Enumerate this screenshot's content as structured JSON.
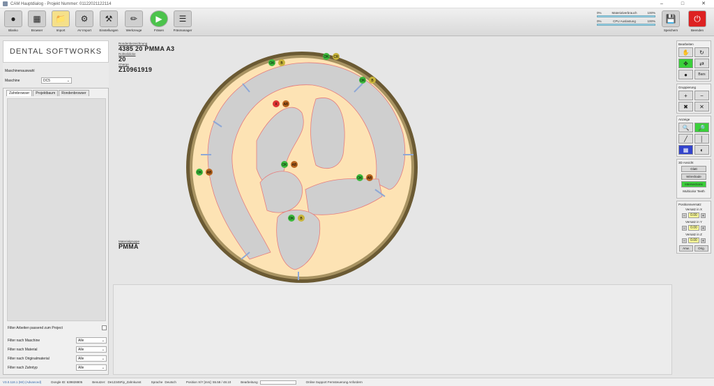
{
  "window": {
    "title": "CAM Hauptdialog - Projekt Nummer: 01122021122114"
  },
  "toolbar": {
    "buttons": [
      {
        "label": "Blanko",
        "icon": "blank-disc-icon"
      },
      {
        "label": "Browser",
        "icon": "browser-icon"
      },
      {
        "label": "Import",
        "icon": "import-icon"
      },
      {
        "label": "AV Import",
        "icon": "av-import-icon"
      },
      {
        "label": "Einstellungen",
        "icon": "settings-icon"
      },
      {
        "label": "Werkzeuge",
        "icon": "tools-icon"
      },
      {
        "label": "Fräsen",
        "icon": "play-icon"
      },
      {
        "label": "Fräsmanager",
        "icon": "mill-manager-icon"
      }
    ],
    "meters": [
      {
        "label": "Materialverbrauch",
        "min": "0%",
        "max": "100%"
      },
      {
        "label": "CPU Auslastung",
        "min": "0%",
        "max": "100%"
      }
    ],
    "save_label": "Speichern",
    "exit_label": "Beenden"
  },
  "left": {
    "logo": "DENTAL SOFTWORKS",
    "machine_section": "Maschinenauswahl",
    "machine_label": "Maschine",
    "machine_value": "DC5",
    "tabs": [
      "Zahnbrowser",
      "Projektbaum",
      "Rondenbrowser"
    ],
    "filter_project": "Filter Arbeiten passend zum Project",
    "filters": [
      {
        "label": "Filter nach Maschine",
        "value": "Alle"
      },
      {
        "label": "Filter nach Material",
        "value": "Alle"
      },
      {
        "label": "Filter nach Originalmaterial",
        "value": "Alle"
      },
      {
        "label": "Filter nach Zahntyp",
        "value": "Alle"
      }
    ]
  },
  "info": {
    "designation_label": "Rondenbezeichnung",
    "designation_value": "4385 20 PMMA A3",
    "thickness_label": "Rohteildicke",
    "thickness_value": "20",
    "batch_label": "Charge",
    "batch_value": "Z10961919",
    "material_group_label": "Materialgruppe",
    "material_group_value": "PMMA"
  },
  "disc": {
    "badges": [
      {
        "a": "OK",
        "b": "B"
      },
      {
        "a": "OK",
        "b": "CR"
      },
      {
        "a": "OK",
        "b": "B"
      },
      {
        "a": "X",
        "b": "AB"
      },
      {
        "a": "OK",
        "b": "AB"
      },
      {
        "a": "OK",
        "b": "AB"
      },
      {
        "a": "OK",
        "b": "AB"
      },
      {
        "a": "OK",
        "b": "B"
      }
    ]
  },
  "right": {
    "edit_label": "Bearbeiten",
    "edit_sub": "Bars",
    "group_label": "Gruppierung",
    "view_label": "Anzeige",
    "view3d_label": "3D Ansicht",
    "view3d_buttons": [
      "Glatt",
      "Wireshade",
      "Intersections",
      "Multicolor Teeth"
    ],
    "offset_label": "Positionsversatz",
    "offset_x_label": "Versatz in X",
    "offset_y_label": "Versatz in Y",
    "offset_z_label": "Versatz in Z",
    "offset_x": "0.00",
    "offset_y": "0.00",
    "offset_z": "0.00",
    "apply_label": "Anw.",
    "orig_label": "Orig."
  },
  "status": {
    "version": "V3.0.118.1 (Mr) (Advanced)",
    "dongle": "Dongle ID: 639828805",
    "user_label": "Benutzer:",
    "user": "De12345Fip_Zahnkunst",
    "lang_label": "Sprache",
    "lang": "Deutsch",
    "position": "Position X/Y [mm]: 55.58 / 48.10",
    "editing": "Bearbeitung",
    "support": "Online Support Fernsteuerung Anfordern"
  },
  "colors": {
    "disc_fill": "#fde3b4",
    "disc_ring": "#5a4a2a",
    "ok_green": "#3cb83c",
    "warn_red": "#d33",
    "badge_orange": "#b8641e"
  }
}
